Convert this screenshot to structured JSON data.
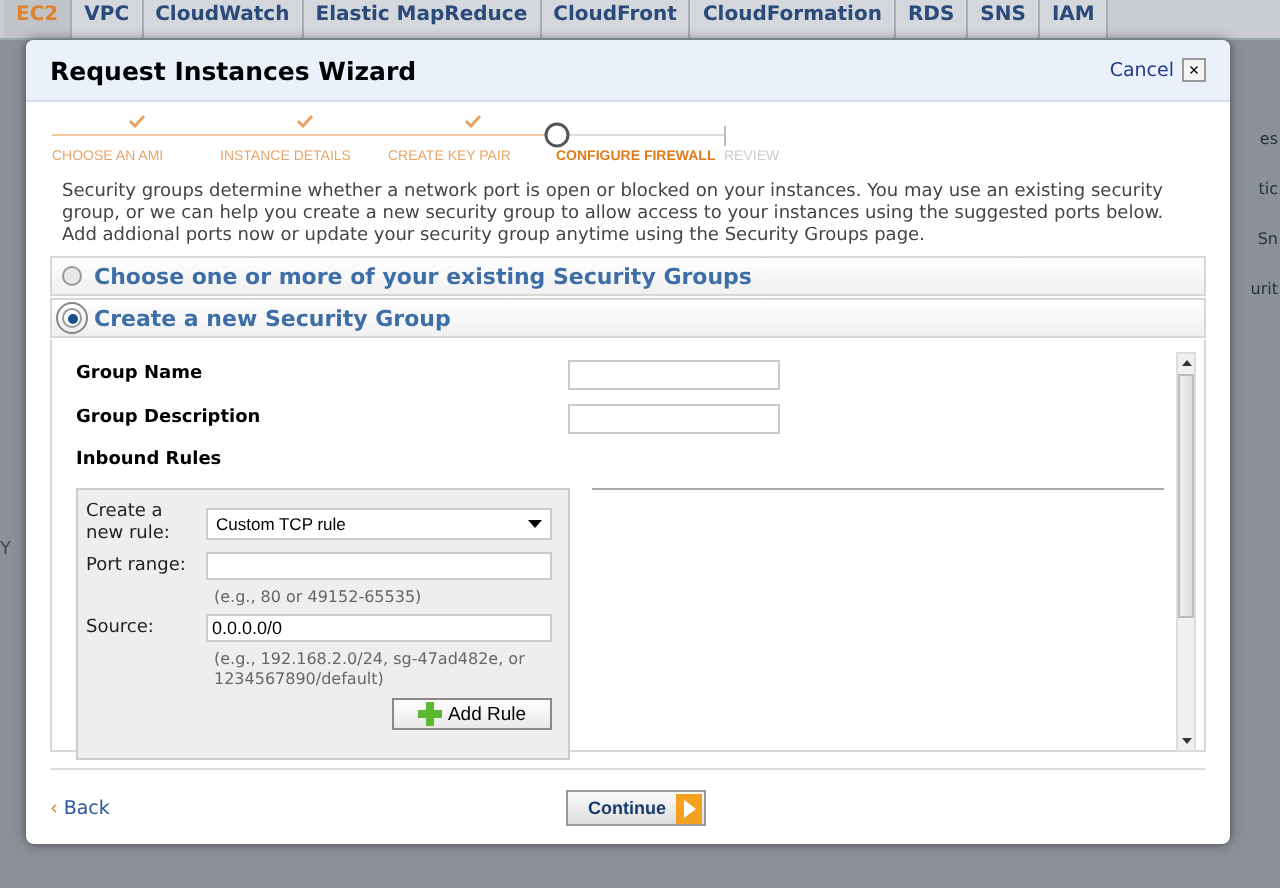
{
  "top_tabs": [
    {
      "label": "EC2",
      "selected": true
    },
    {
      "label": "VPC",
      "selected": false
    },
    {
      "label": "CloudWatch",
      "selected": false
    },
    {
      "label": "Elastic MapReduce",
      "selected": false
    },
    {
      "label": "CloudFront",
      "selected": false
    },
    {
      "label": "CloudFormation",
      "selected": false
    },
    {
      "label": "RDS",
      "selected": false
    },
    {
      "label": "SNS",
      "selected": false
    },
    {
      "label": "IAM",
      "selected": false
    }
  ],
  "background_fragments": {
    "left": "Y",
    "right": [
      "es",
      "tic",
      "Sn",
      "urit"
    ]
  },
  "dialog": {
    "title": "Request Instances Wizard",
    "cancel": "Cancel",
    "close": "×",
    "steps": [
      {
        "label": "CHOOSE AN AMI",
        "kind": "done"
      },
      {
        "label": "INSTANCE DETAILS",
        "kind": "done"
      },
      {
        "label": "CREATE KEY PAIR",
        "kind": "done"
      },
      {
        "label": "CONFIGURE FIREWALL",
        "kind": "current"
      },
      {
        "label": "REVIEW",
        "kind": "todo"
      }
    ],
    "intro": "Security groups determine whether a network port is open or blocked on your instances. You may use an existing security group, or we can help you create a new security group to allow access to your instances using the suggested ports below. Add addional ports now or update your security group anytime using the Security Groups page.",
    "options": [
      {
        "label": "Choose one or more of your existing Security Groups",
        "selected": false
      },
      {
        "label": "Create a new Security Group",
        "selected": true
      }
    ],
    "group_name": {
      "label": "Group Name"
    },
    "group_description": {
      "label": "Group Description"
    },
    "inbound_rules": {
      "title": "Inbound Rules",
      "new_rule": {
        "label": "Create a new rule:",
        "value": "Custom TCP rule"
      },
      "port_range": {
        "label": "Port range:",
        "hint": "(e.g., 80 or 49152-65535)"
      },
      "source": {
        "label": "Source:",
        "value": "0.0.0.0/0",
        "hint": "(e.g., 192.168.2.0/24, sg-47ad482e, or 1234567890/default)"
      },
      "add_button": "Add Rule"
    },
    "back": "Back",
    "back_mark": "‹",
    "continue": "Continue"
  }
}
